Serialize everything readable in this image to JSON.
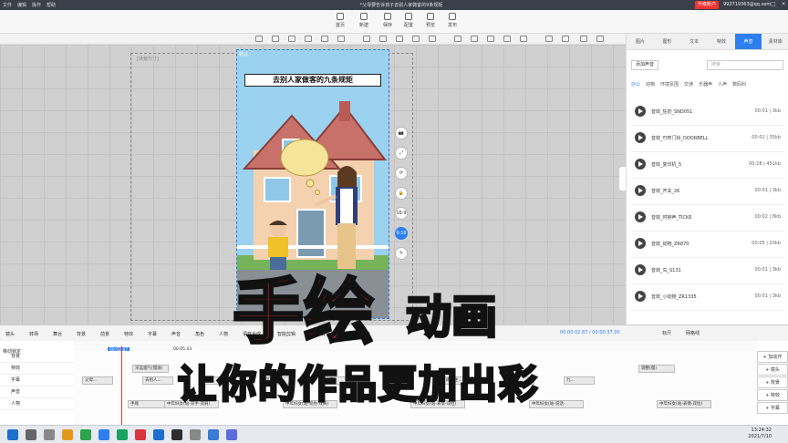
{
  "window": {
    "menu": [
      "文件",
      "编辑",
      "操作",
      "帮助"
    ],
    "title": "*父母要告诉孩子去别人家做客的9条规矩",
    "upgrade_label": "升级账户",
    "account": "993719363@qq.com"
  },
  "toolbar": {
    "items": [
      "首页",
      "新建",
      "保存",
      "配置",
      "预览",
      "发布"
    ]
  },
  "canvas": {
    "frame_label": "[场景尺寸]",
    "phone_tag": "默认",
    "scene_title": "去别人家做客的九条规矩",
    "side_tools": [
      "📷",
      "⤢",
      "⟳",
      "🔒",
      "16:9",
      "9:16",
      "✎"
    ]
  },
  "right_panel": {
    "tabs": [
      "图片",
      "图形",
      "文本",
      "特效",
      "声音",
      "素材库"
    ],
    "active_tab": 4,
    "add_sound_label": "添加声音",
    "search_placeholder": "搜索",
    "categories": [
      "办公",
      "动物",
      "环境氛围",
      "交通",
      "乐器声",
      "人声",
      "数码科"
    ],
    "active_category": 0,
    "sounds": [
      {
        "name": "音效_狂奶_SND051",
        "duration": "00:01 | 3kb"
      },
      {
        "name": "音效_叮咚门铃_DOORBELL",
        "duration": "00:01 | 35kb"
      },
      {
        "name": "音效_复印机_5",
        "duration": "00:28 | 451kb"
      },
      {
        "name": "音效_开关_26",
        "duration": "00:01 | 3kb"
      },
      {
        "name": "音效_时钟声_TICK6",
        "duration": "00:02 | 8kb"
      },
      {
        "name": "音效_动物_ZR870",
        "duration": "00:05 | 20kb"
      },
      {
        "name": "音效_鸟_S131",
        "duration": "00:01 | 3kb"
      },
      {
        "name": "音效_小动物_ZR1335",
        "duration": "00:01 | 3kb"
      }
    ]
  },
  "timeline": {
    "tabs": [
      "镜头",
      "转场",
      "舞台",
      "背景",
      "前景",
      "特效",
      "字幕",
      "声音",
      "角色",
      "人物",
      "语音合成",
      "智能剪辑",
      "一键去背景",
      "去除静音"
    ],
    "current_time": "00:00:02.87 / 00:00:37.00",
    "zoom_label": "标尺",
    "grid_label": "网格线",
    "playhead_time": "00:02.87",
    "marker_time": "00:05.43",
    "tracks": [
      "背景",
      "特效",
      "字幕",
      "声音",
      "人物"
    ],
    "lock_label": "移动锁定",
    "clips": [
      {
        "track": 1,
        "text": "深蓝烟气(慢速)"
      },
      {
        "track": 1,
        "text": "调整(慢)"
      },
      {
        "track": 2,
        "text": "父母..."
      },
      {
        "track": 2,
        "text": "去别人..."
      },
      {
        "track": 2,
        "text": "一..."
      },
      {
        "track": 2,
        "text": "见到长..."
      },
      {
        "track": 2,
        "text": "...真..."
      },
      {
        "track": 2,
        "text": "...大..."
      },
      {
        "track": 2,
        "text": "即使主..."
      },
      {
        "track": 2,
        "text": "离开..."
      },
      {
        "track": 2,
        "text": "九..."
      },
      {
        "track": 4,
        "text": "手贱"
      },
      {
        "track": 4,
        "text": "中年妇女(站-双手-双肩)"
      },
      {
        "track": 4,
        "text": "中年妇女(站-双抬-双肩)"
      },
      {
        "track": 4,
        "text": "中年妇女(站-表情-双拉)"
      },
      {
        "track": 4,
        "text": "中年妇女(站-说话-"
      },
      {
        "track": 4,
        "text": "中年妇女(站-表情-双拉)"
      }
    ],
    "right_buttons": [
      "+ 加动作",
      "+ 镜头",
      "+ 背景",
      "+ 特效",
      "+ 字幕"
    ]
  },
  "overlay": {
    "headline_1a": "手绘",
    "headline_1b": "动画",
    "headline_2": "让你的作品更加出彩"
  },
  "taskbar": {
    "time": "13:24:32",
    "date": "2021/7/10"
  }
}
